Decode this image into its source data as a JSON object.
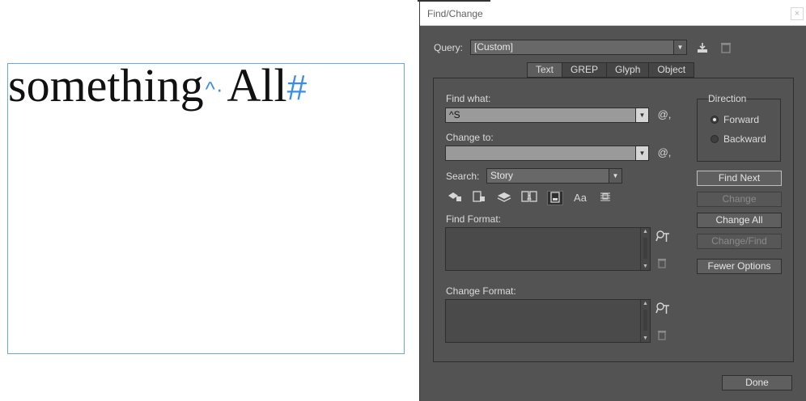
{
  "canvas": {
    "word1": "something",
    "caret_marker": "^·",
    "word2": "All",
    "hash_marker": "#"
  },
  "dialog": {
    "title": "Find/Change",
    "close_glyph": "×",
    "query_label": "Query:",
    "query_value": "[Custom]",
    "tabs": [
      "Text",
      "GREP",
      "Glyph",
      "Object"
    ],
    "find_what_label": "Find what:",
    "find_what_value": "^S",
    "change_to_label": "Change to:",
    "change_to_value": "",
    "at_glyph": "@,",
    "search_label": "Search:",
    "search_value": "Story",
    "case_option": "Aa",
    "find_format_label": "Find Format:",
    "change_format_label": "Change Format:",
    "direction_label": "Direction",
    "forward_label": "Forward",
    "backward_label": "Backward",
    "buttons": {
      "find_next": "Find Next",
      "change": "Change",
      "change_all": "Change All",
      "change_find": "Change/Find",
      "fewer_options": "Fewer Options",
      "done": "Done"
    }
  }
}
